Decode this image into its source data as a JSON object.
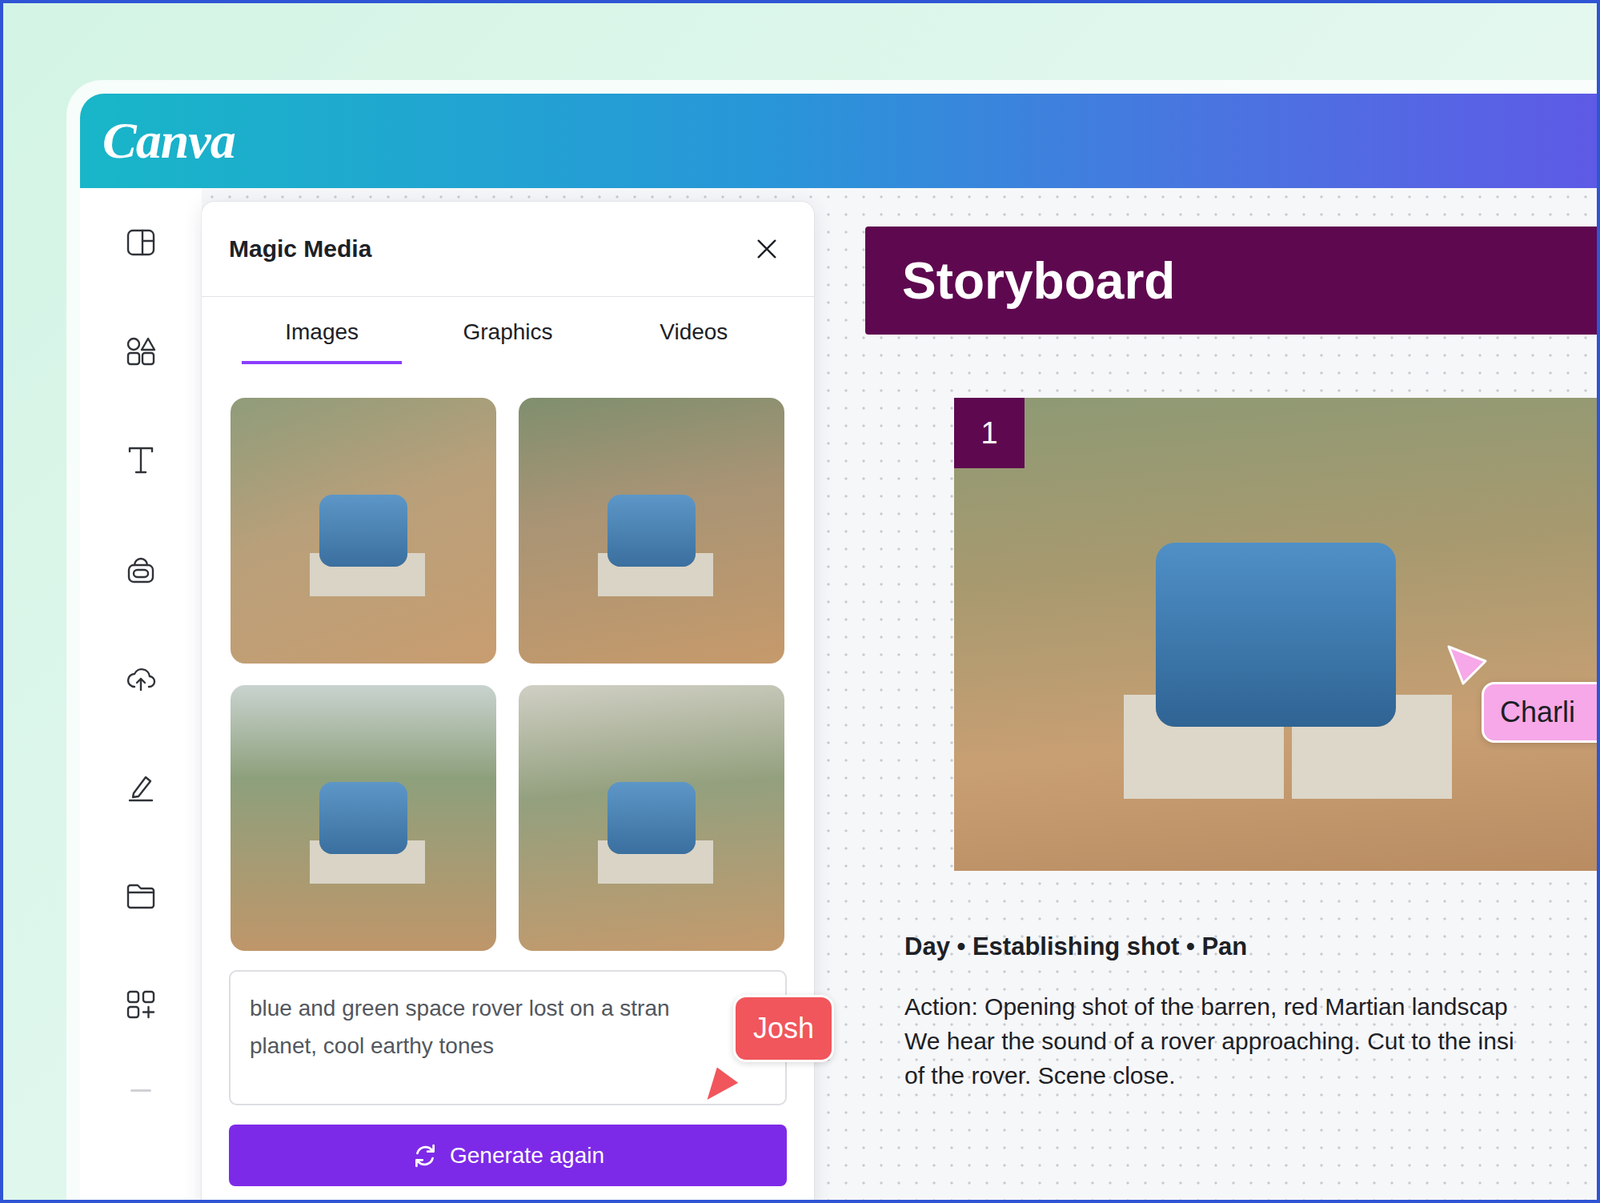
{
  "app": {
    "logo": "Canva"
  },
  "panel": {
    "title": "Magic Media"
  },
  "tabs": [
    {
      "label": "Images",
      "selected": true
    },
    {
      "label": "Graphics",
      "selected": false
    },
    {
      "label": "Videos",
      "selected": false
    }
  ],
  "prompt": {
    "lines": [
      "blue and green space rover lost on a stran",
      "planet, cool earthy tones"
    ]
  },
  "generate_button": {
    "label": "Generate again"
  },
  "collaborators": [
    {
      "name": "Josh",
      "color": "#f0565c"
    },
    {
      "name": "Charli",
      "color": "#f6a8e8"
    }
  ],
  "storyboard": {
    "title": "Storyboard",
    "frames": [
      {
        "number": "1",
        "heading": "Day • Establishing shot • Pan",
        "action_lines": [
          "Action: Opening shot of the barren, red Martian landscap",
          "We hear the sound of a rover approaching. Cut to the insi",
          "of the rover. Scene close."
        ]
      }
    ]
  }
}
